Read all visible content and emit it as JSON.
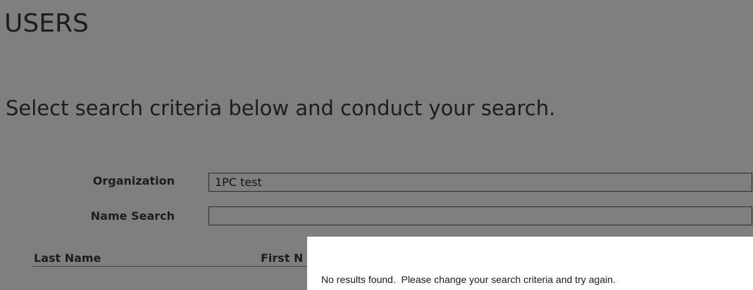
{
  "page": {
    "title": "USERS",
    "subtitle": "Select search criteria below and conduct your search."
  },
  "form": {
    "organization": {
      "label": "Organization",
      "value": "1PC test"
    },
    "name_search": {
      "label": "Name Search",
      "value": ""
    }
  },
  "results_table": {
    "columns": [
      "Last Name",
      "First N"
    ]
  },
  "dialog": {
    "message": "No results found.  Please change your search criteria and try again."
  }
}
